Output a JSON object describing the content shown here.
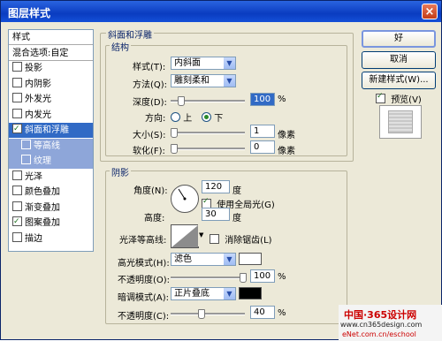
{
  "window": {
    "title": "图层样式",
    "close": "×"
  },
  "left_list": {
    "items": [
      {
        "label": "样式",
        "checkbox": false,
        "checked": false,
        "state": "header"
      },
      {
        "label": "混合选项:自定",
        "checkbox": false,
        "checked": false,
        "state": "header"
      },
      {
        "label": "投影",
        "checkbox": true,
        "checked": false,
        "state": "normal"
      },
      {
        "label": "内阴影",
        "checkbox": true,
        "checked": false,
        "state": "normal"
      },
      {
        "label": "外发光",
        "checkbox": true,
        "checked": false,
        "state": "normal"
      },
      {
        "label": "内发光",
        "checkbox": true,
        "checked": false,
        "state": "normal"
      },
      {
        "label": "斜面和浮雕",
        "checkbox": true,
        "checked": true,
        "state": "selected"
      },
      {
        "label": "等高线",
        "checkbox": true,
        "checked": false,
        "state": "sub"
      },
      {
        "label": "纹理",
        "checkbox": true,
        "checked": false,
        "state": "sub"
      },
      {
        "label": "光泽",
        "checkbox": true,
        "checked": false,
        "state": "normal"
      },
      {
        "label": "颜色叠加",
        "checkbox": true,
        "checked": false,
        "state": "normal"
      },
      {
        "label": "渐变叠加",
        "checkbox": true,
        "checked": false,
        "state": "normal"
      },
      {
        "label": "图案叠加",
        "checkbox": true,
        "checked": true,
        "state": "normal"
      },
      {
        "label": "描边",
        "checkbox": true,
        "checked": false,
        "state": "normal"
      }
    ]
  },
  "bevel": {
    "group_title": "斜面和浮雕",
    "structure_title": "结构",
    "style_label": "样式(T):",
    "style_value": "内斜面",
    "technique_label": "方法(Q):",
    "technique_value": "雕刻柔和",
    "depth_label": "深度(D):",
    "depth_value": "100",
    "depth_unit": "%",
    "depth_level": 0.1,
    "direction_label": "方向:",
    "dir_up": "上",
    "dir_down": "下",
    "dir_selected": "down",
    "size_label": "大小(S):",
    "size_value": "1",
    "size_unit": "像素",
    "size_level": 0.0,
    "soften_label": "软化(F):",
    "soften_value": "0",
    "soften_unit": "像素",
    "soften_level": 0.0
  },
  "shading": {
    "group_title": "阴影",
    "angle_label": "角度(N):",
    "angle_value": "120",
    "angle_unit": "度",
    "global_light_label": "使用全局光(G)",
    "global_light_checked": true,
    "altitude_label": "高度:",
    "altitude_value": "30",
    "altitude_unit": "度",
    "gloss_label": "光泽等高线:",
    "antialias_label": "消除锯齿(L)",
    "antialias_checked": false,
    "highlight_mode_label": "高光模式(H):",
    "highlight_mode_value": "滤色",
    "highlight_color": "#ffffff",
    "highlight_opacity_label": "不透明度(O):",
    "highlight_opacity_value": "100",
    "highlight_opacity_unit": "%",
    "highlight_opacity_level": 1.0,
    "shadow_mode_label": "暗调模式(A):",
    "shadow_mode_value": "正片叠底",
    "shadow_color": "#000000",
    "shadow_opacity_label": "不透明度(C):",
    "shadow_opacity_value": "40",
    "shadow_opacity_unit": "%",
    "shadow_opacity_level": 0.4
  },
  "buttons": {
    "ok": "好",
    "cancel": "取消",
    "new_style": "新建样式(W)...",
    "preview_label": "预览(V)",
    "preview_checked": true
  },
  "watermark": {
    "line1": "中国·365设计网",
    "line2": "www.cn365design.com",
    "line3": "eNet.com.cn/eschool"
  }
}
